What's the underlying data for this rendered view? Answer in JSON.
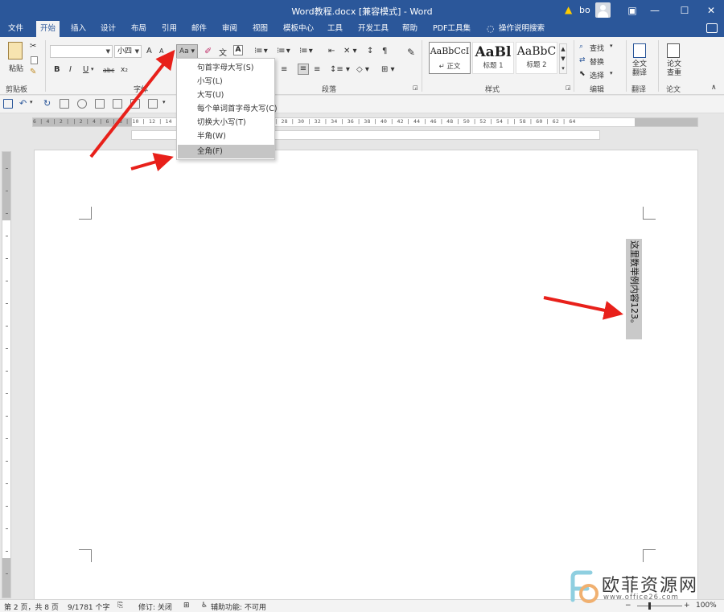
{
  "window": {
    "title": "Word教程.docx [兼容模式]  -  Word",
    "user": "bo",
    "minimize": "—",
    "restore": "❐",
    "maximize": "☐",
    "close": "✕"
  },
  "tabs": [
    "文件",
    "开始",
    "插入",
    "设计",
    "布局",
    "引用",
    "邮件",
    "审阅",
    "视图",
    "模板中心",
    "工具",
    "开发工具",
    "帮助",
    "PDF工具集",
    "操作说明搜索"
  ],
  "active_tab": "开始",
  "ribbon": {
    "clipboard": {
      "paste": "粘贴",
      "label": "剪贴板"
    },
    "font": {
      "font_name": "",
      "font_size": "小四",
      "grow": "A",
      "shrink": "A",
      "change_case": "Aa",
      "bold": "B",
      "italic": "I",
      "underline": "U",
      "strike": "abc",
      "subscript": "x₂",
      "label": "字体"
    },
    "paragraph": {
      "label": "段落"
    },
    "styles": {
      "items": [
        {
          "sample": "AaBbCcI",
          "name": "↵ 正文"
        },
        {
          "sample": "AaBl",
          "name": "标题 1"
        },
        {
          "sample": "AaBbC",
          "name": "标题 2"
        }
      ],
      "label": "样式"
    },
    "editing": {
      "find": "查找",
      "replace": "替换",
      "select": "选择",
      "label": "编辑"
    },
    "translate": {
      "full": "全文",
      "full2": "翻译",
      "label": "翻译"
    },
    "paper": {
      "check": "论文",
      "check2": "查重",
      "label": "论文"
    }
  },
  "ruler": {
    "h_numbers": "6 | 4 | 2 |   | 2 | 4 | 6 | 8 | 10 | 12 | 14 | 16 | 18 | 20 | 22 | 24 | 26 | 28 | 30 | 32 | 34 | 36 | 38 | 40 | 42 | 44 | 46 | 48 | 50 | 52 | 54 |   | 58 | 60 | 62 | 64"
  },
  "change_case_menu": [
    "句首字母大写(S)",
    "小写(L)",
    "大写(U)",
    "每个单词首字母大写(C)",
    "切换大小写(T)",
    "半角(W)",
    "全角(F)"
  ],
  "highlighted_menu_item": "全角(F)",
  "document": {
    "vertical_text": "这里数举例内容123。"
  },
  "status": {
    "page": "第 2 页，共 8 页",
    "words": "9/1781 个字",
    "track": "修订: 关闭",
    "accessibility": "辅助功能: 不可用",
    "zoom": "100%"
  },
  "watermark": {
    "name": "欧菲资源网",
    "url": "www.office26.com"
  },
  "colors": {
    "title_bar": "#2b579a",
    "arrow": "#e8201a",
    "highlight": "#c5c5c5"
  }
}
